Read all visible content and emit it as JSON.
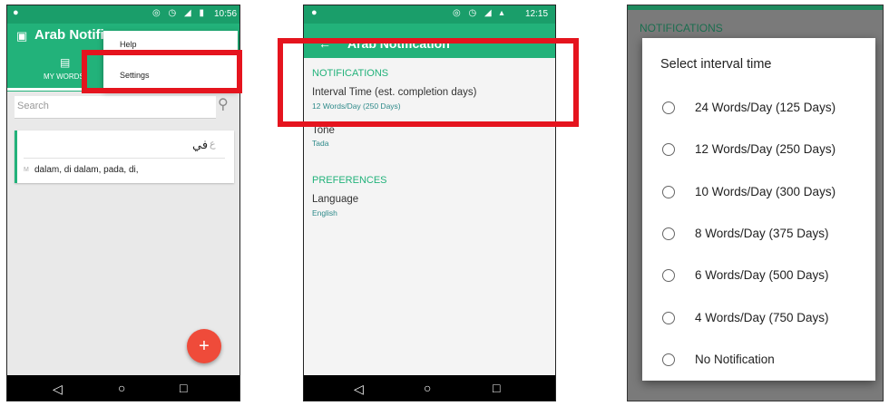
{
  "phone1": {
    "status_time": "10:56",
    "app_title": "Arab Notifica",
    "tab_my_words": "MY WORDS",
    "overflow_menu": {
      "items": [
        "Help",
        "Settings"
      ]
    },
    "search": {
      "placeholder": "Search"
    },
    "word_card": {
      "arabic": "في",
      "arabic_marker": "ع",
      "meaning_marker": "M",
      "meaning": "dalam, di dalam, pada, di,"
    },
    "fab_label": "+"
  },
  "phone2": {
    "status_time": "12:15",
    "app_title": "Arab Notification",
    "sections": [
      {
        "header": "NOTIFICATIONS",
        "items": [
          {
            "title": "Interval Time (est. completion days)",
            "summary": "12 Words/Day (250 Days)"
          },
          {
            "title": "Tone",
            "summary": "Tada"
          }
        ]
      },
      {
        "header": "PREFERENCES",
        "items": [
          {
            "title": "Language",
            "summary": "English"
          }
        ]
      }
    ]
  },
  "phone3": {
    "background_header": "NOTIFICATIONS",
    "dialog": {
      "title": "Select interval time",
      "options": [
        "24 Words/Day (125 Days)",
        "12 Words/Day (250 Days)",
        "10 Words/Day (300 Days)",
        "8 Words/Day (375 Days)",
        "6 Words/Day (500 Days)",
        "4 Words/Day (750 Days)",
        "No Notification"
      ]
    }
  },
  "nav_icons": [
    "back-icon",
    "home-icon",
    "recents-icon"
  ],
  "colors": {
    "primary": "#22b27a",
    "primary_dark": "#1a9e6a",
    "accent_fab": "#ef4b3a",
    "highlight": "#e5141e"
  }
}
